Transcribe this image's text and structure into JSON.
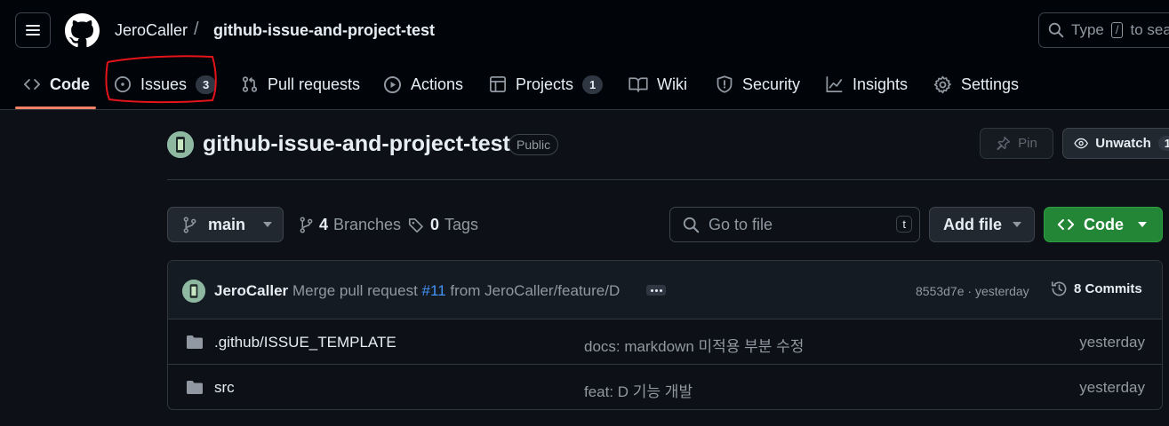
{
  "header": {
    "owner": "JeroCaller",
    "separator": "/",
    "repo": "github-issue-and-project-test",
    "search_placeholder_prefix": "Type",
    "search_key": "/",
    "search_placeholder_suffix": "to sea"
  },
  "tabs": [
    {
      "label": "Code",
      "icon": "code-icon",
      "selected": true
    },
    {
      "label": "Issues",
      "icon": "issue-opened-icon",
      "count": "3"
    },
    {
      "label": "Pull requests",
      "icon": "git-pull-request-icon"
    },
    {
      "label": "Actions",
      "icon": "play-icon"
    },
    {
      "label": "Projects",
      "icon": "table-icon",
      "count": "1"
    },
    {
      "label": "Wiki",
      "icon": "book-icon"
    },
    {
      "label": "Security",
      "icon": "shield-icon"
    },
    {
      "label": "Insights",
      "icon": "graph-icon"
    },
    {
      "label": "Settings",
      "icon": "gear-icon"
    }
  ],
  "repo_head": {
    "title": "github-issue-and-project-test",
    "visibility": "Public",
    "pin_label": "Pin",
    "unwatch_label": "Unwatch",
    "unwatch_count": "1"
  },
  "toolbar": {
    "branch": "main",
    "branches_count": "4",
    "branches_label": "Branches",
    "tags_count": "0",
    "tags_label": "Tags",
    "goto_placeholder": "Go to file",
    "goto_key": "t",
    "add_file_label": "Add file",
    "code_label": "Code"
  },
  "latest_commit": {
    "author": "JeroCaller",
    "message_prefix": "Merge pull request",
    "pr_link": "#11",
    "message_suffix": "from JeroCaller/feature/D",
    "hash_time": "8553d7e · yesterday",
    "commits_label": "8 Commits"
  },
  "files": [
    {
      "name": ".github/ISSUE_TEMPLATE",
      "message": "docs: markdown 미적용 부분 수정",
      "date": "yesterday",
      "icon": "folder-icon"
    },
    {
      "name": "src",
      "message": "feat: D 기능 개발",
      "date": "yesterday",
      "icon": "folder-icon"
    }
  ],
  "colors": {
    "background": "#0d1117",
    "header_bg": "#010409",
    "accent_underline": "#f78166",
    "link": "#4493f8",
    "primary_button": "#238636",
    "annotation_circle": "#e5131a"
  }
}
